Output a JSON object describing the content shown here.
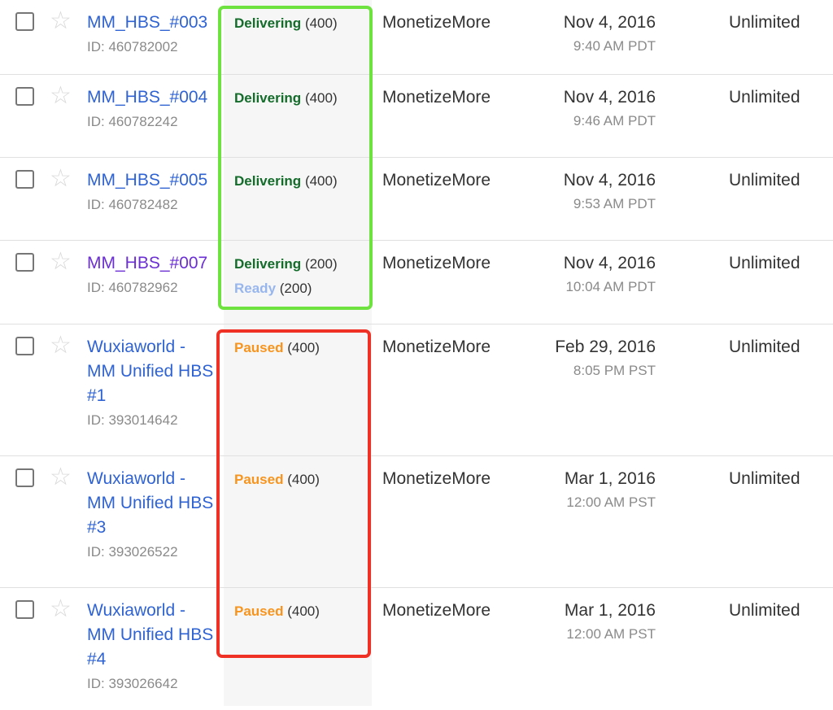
{
  "rows": [
    {
      "name": "MM_HBS_#003",
      "id_label": "ID: 460782002",
      "statuses": [
        {
          "word": "Delivering",
          "count": "(400)",
          "kind": "delivering"
        }
      ],
      "advertiser": "MonetizeMore",
      "date": "Nov 4, 2016",
      "time": "9:40 AM PDT",
      "goal": "Unlimited"
    },
    {
      "name": "MM_HBS_#004",
      "id_label": "ID: 460782242",
      "statuses": [
        {
          "word": "Delivering",
          "count": "(400)",
          "kind": "delivering"
        }
      ],
      "advertiser": "MonetizeMore",
      "date": "Nov 4, 2016",
      "time": "9:46 AM PDT",
      "goal": "Unlimited"
    },
    {
      "name": "MM_HBS_#005",
      "id_label": "ID: 460782482",
      "statuses": [
        {
          "word": "Delivering",
          "count": "(400)",
          "kind": "delivering"
        }
      ],
      "advertiser": "MonetizeMore",
      "date": "Nov 4, 2016",
      "time": "9:53 AM PDT",
      "goal": "Unlimited"
    },
    {
      "name": "MM_HBS_#007",
      "id_label": "ID: 460782962",
      "statuses": [
        {
          "word": "Delivering",
          "count": "(200)",
          "kind": "delivering"
        },
        {
          "word": "Ready",
          "count": "(200)",
          "kind": "ready"
        }
      ],
      "advertiser": "MonetizeMore",
      "date": "Nov 4, 2016",
      "time": "10:04 AM PDT",
      "goal": "Unlimited"
    },
    {
      "name": "Wuxiaworld - MM Unified HBS #1",
      "id_label": "ID: 393014642",
      "statuses": [
        {
          "word": "Paused",
          "count": "(400)",
          "kind": "paused"
        }
      ],
      "advertiser": "MonetizeMore",
      "date": "Feb 29, 2016",
      "time": "8:05 PM PST",
      "goal": "Unlimited"
    },
    {
      "name": "Wuxiaworld - MM Unified HBS #3",
      "id_label": "ID: 393026522",
      "statuses": [
        {
          "word": "Paused",
          "count": "(400)",
          "kind": "paused"
        }
      ],
      "advertiser": "MonetizeMore",
      "date": "Mar 1, 2016",
      "time": "12:00 AM PST",
      "goal": "Unlimited"
    },
    {
      "name": "Wuxiaworld - MM Unified HBS #4",
      "id_label": "ID: 393026642",
      "statuses": [
        {
          "word": "Paused",
          "count": "(400)",
          "kind": "paused"
        }
      ],
      "advertiser": "MonetizeMore",
      "date": "Mar 1, 2016",
      "time": "12:00 AM PST",
      "goal": "Unlimited"
    }
  ],
  "icons": {
    "checkbox": "checkbox-icon",
    "star": "star-icon"
  },
  "colors": {
    "link": "#2f63d3",
    "visited_link": "#6b2fd3",
    "delivering": "#146c2b",
    "ready": "#98b6ee",
    "paused": "#f7941d",
    "highlight_green": "#6ee23e",
    "highlight_red": "#ef3125"
  }
}
